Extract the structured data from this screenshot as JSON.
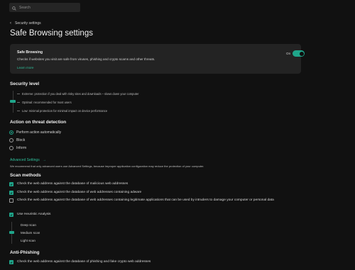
{
  "search": {
    "placeholder": "Search",
    "icon": "search-icon"
  },
  "breadcrumb": {
    "label": "Security settings",
    "icon": "chevron-left-icon"
  },
  "page_title": "Safe Browsing settings",
  "card": {
    "title": "Safe Browsing",
    "description": "Checks if websites you visit are safe from viruses, phishing and crypto scams and other threats.",
    "learn_more": "Learn more",
    "toggle_label": "On",
    "toggle_on": true
  },
  "security_level": {
    "heading": "Security level",
    "levels": [
      "Extreme: protection if you deal with risky sites and downloads – slows down your computer",
      "Optimal: recommended for most users",
      "Low: minimal protection for minimal impact on device performance"
    ],
    "selected": "Optimal: recommended for most users"
  },
  "threat_action": {
    "heading": "Action on threat detection",
    "options": [
      "Perform action automatically",
      "Block",
      "Inform"
    ],
    "selected": "Perform action automatically"
  },
  "advanced": {
    "link": "Advanced Settings",
    "arrow": "→",
    "note": "We recommend that only advanced users use Advanced Settings, because improper application configuration may reduce the protection of your computer."
  },
  "scan_methods": {
    "heading": "Scan methods",
    "items": [
      {
        "label": "Check the web address against the database of malicious web addresses",
        "checked": true
      },
      {
        "label": "Check the web address against the database of web addresses containing adware",
        "checked": true
      },
      {
        "label": "Check the web address against the database of web addresses containing legitimate applications that can be used by intruders to damage your computer or personal data",
        "checked": false
      },
      {
        "label": "Use Heuristic Analysis",
        "checked": true
      }
    ],
    "heuristic_levels": [
      "Deep scan",
      "Medium scan",
      "Light scan"
    ],
    "heuristic_selected": "Medium scan"
  },
  "anti_phishing": {
    "heading": "Anti-Phishing",
    "items": [
      {
        "label": "Check the web address against the database of phishing and fake crypto web addresses",
        "checked": true
      }
    ]
  },
  "colors": {
    "accent": "#1fa58a",
    "link": "#2fbf9a",
    "background": "#111111",
    "card": "#232323"
  }
}
